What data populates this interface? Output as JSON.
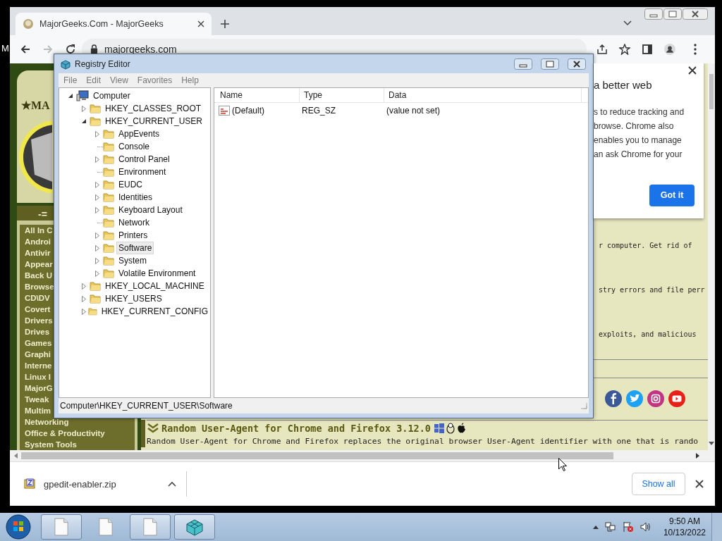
{
  "stray_text": "M",
  "browser": {
    "tabs": [
      {
        "title": "MajorGeeks.Com - MajorGeeks",
        "selected": true
      }
    ],
    "address": "majorgeeks.com"
  },
  "page": {
    "logo_text": "★MA",
    "sidebar_heading": "-=",
    "categories": [
      "All In C",
      "Androi",
      "Antivir",
      "Appear",
      "Back U",
      "Browse",
      "CD\\DV",
      "Covert",
      "Drivers",
      "Drives",
      "Games",
      "Graphi",
      "Interne",
      "Linux I",
      "MajorG\nTweak",
      "Multim",
      "Networking",
      "Office & Productivity",
      "System Tools"
    ],
    "snippets": [
      "r computer. Get rid of",
      "stry errors and file perr",
      "exploits, and malicious"
    ],
    "article": {
      "title": "Random User-Agent for Chrome and Firefox 3.12.0",
      "description": "Random User-Agent for Chrome and Firefox replaces the original browser User-Agent identifier with one that is rando"
    }
  },
  "popup": {
    "title": "a better web",
    "lines": [
      "s to reduce tracking and",
      "browse. Chrome also",
      "enables you to manage",
      "an ask Chrome for your"
    ],
    "button": "Got it"
  },
  "downloads": {
    "file": "gpedit-enabler.zip",
    "show_all": "Show all"
  },
  "regedit": {
    "title": "Registry Editor",
    "menu": [
      "File",
      "Edit",
      "View",
      "Favorites",
      "Help"
    ],
    "tree": [
      {
        "label": "Computer",
        "expanded": true,
        "selected": false,
        "children": [
          {
            "label": "HKEY_CLASSES_ROOT",
            "expanded": false,
            "selected": false
          },
          {
            "label": "HKEY_CURRENT_USER",
            "expanded": true,
            "selected": false,
            "children": [
              {
                "label": "AppEvents",
                "expanded": false,
                "selected": false
              },
              {
                "label": "Console",
                "selected": false
              },
              {
                "label": "Control Panel",
                "expanded": false,
                "selected": false
              },
              {
                "label": "Environment",
                "selected": false
              },
              {
                "label": "EUDC",
                "expanded": false,
                "selected": false
              },
              {
                "label": "Identities",
                "expanded": false,
                "selected": false
              },
              {
                "label": "Keyboard Layout",
                "expanded": false,
                "selected": false
              },
              {
                "label": "Network",
                "selected": false
              },
              {
                "label": "Printers",
                "expanded": false,
                "selected": false
              },
              {
                "label": "Software",
                "expanded": false,
                "selected": true
              },
              {
                "label": "System",
                "expanded": false,
                "selected": false
              },
              {
                "label": "Volatile Environment",
                "expanded": false,
                "selected": false
              }
            ]
          },
          {
            "label": "HKEY_LOCAL_MACHINE",
            "expanded": false,
            "selected": false
          },
          {
            "label": "HKEY_USERS",
            "expanded": false,
            "selected": false
          },
          {
            "label": "HKEY_CURRENT_CONFIG",
            "expanded": false,
            "selected": false
          }
        ]
      }
    ],
    "table": {
      "columns": [
        "Name",
        "Type",
        "Data"
      ],
      "rows": [
        {
          "cells": [
            "(Default)",
            "REG_SZ",
            "(value not set)"
          ]
        }
      ]
    },
    "status": "Computer\\HKEY_CURRENT_USER\\Software"
  },
  "taskbar": {
    "buttons": [
      {
        "kind": "document",
        "running": true
      },
      {
        "kind": "document",
        "running": false
      },
      {
        "kind": "document",
        "running": true
      },
      {
        "kind": "regedit",
        "running": true
      }
    ],
    "time": "9:50 AM",
    "date": "10/13/2022"
  }
}
